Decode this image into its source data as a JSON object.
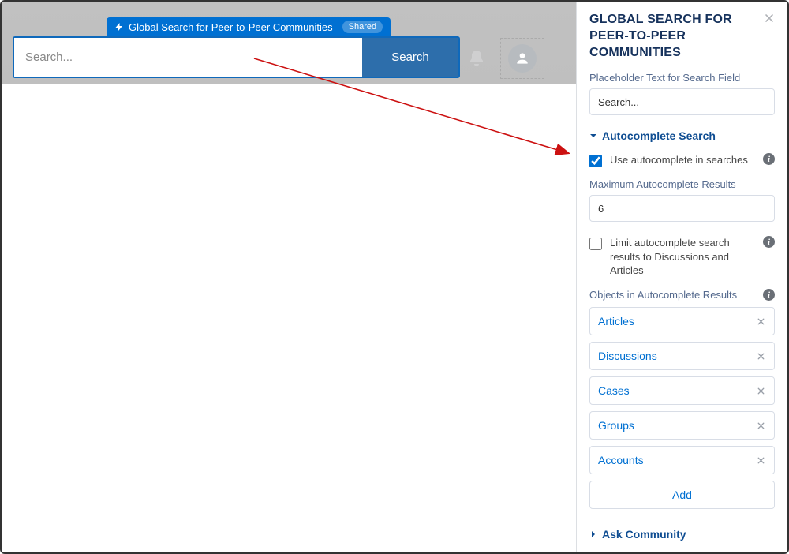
{
  "header": {
    "component_tab": "Global Search for Peer-to-Peer Communities",
    "shared_badge": "Shared",
    "search_placeholder": "Search...",
    "search_button": "Search"
  },
  "panel": {
    "title": "GLOBAL SEARCH FOR PEER-TO-PEER COMMUNITIES",
    "placeholder_field_label": "Placeholder Text for Search Field",
    "placeholder_field_value": "Search...",
    "autocomplete_section": "Autocomplete Search",
    "use_autocomplete_label": "Use autocomplete in searches",
    "use_autocomplete_checked": true,
    "max_results_label": "Maximum Autocomplete Results",
    "max_results_value": "6",
    "limit_label": "Limit autocomplete search results to Discussions and Articles",
    "limit_checked": false,
    "objects_label": "Objects in Autocomplete Results",
    "objects": [
      "Articles",
      "Discussions",
      "Cases",
      "Groups",
      "Accounts"
    ],
    "add_button": "Add",
    "ask_community_section": "Ask Community"
  }
}
